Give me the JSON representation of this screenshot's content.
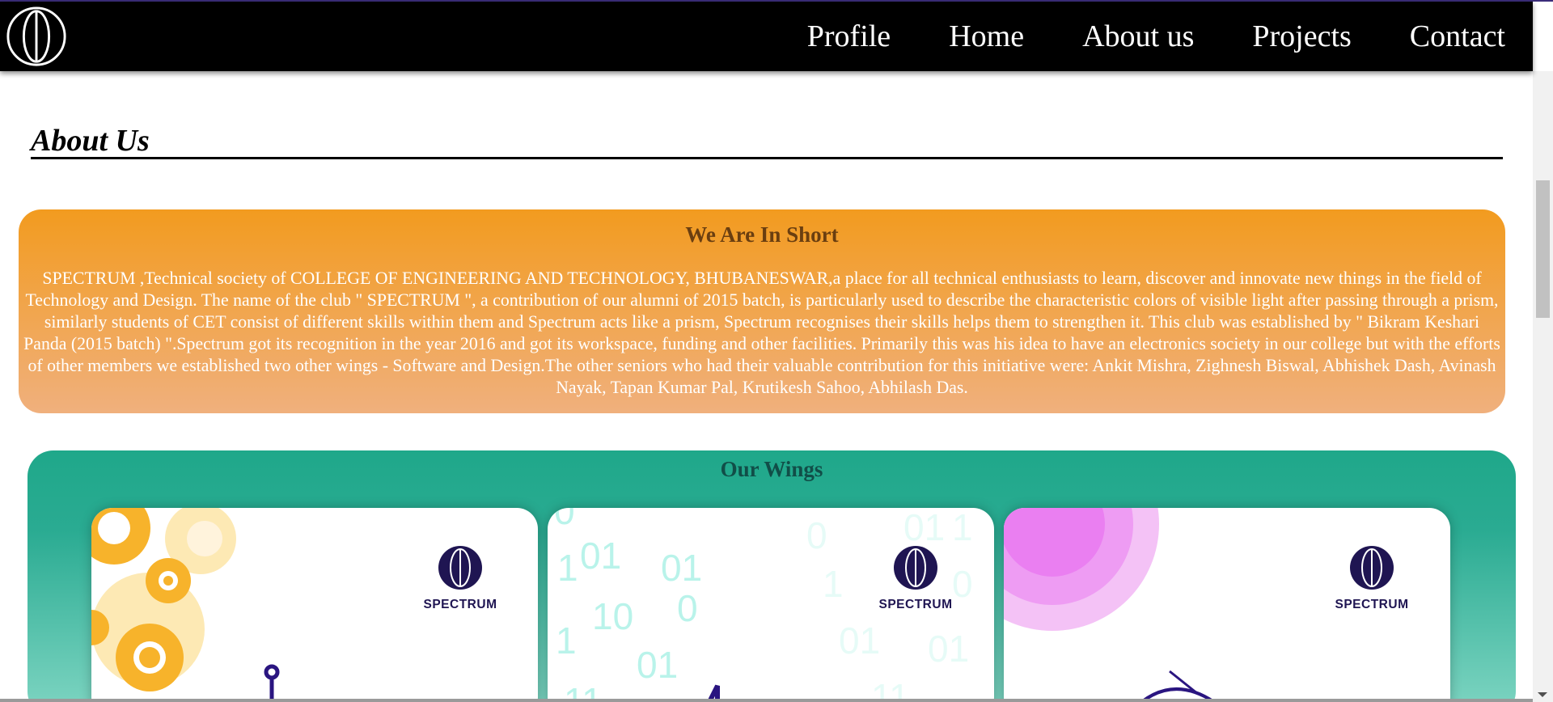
{
  "nav": {
    "logo_icon": "spectrum-logo-icon",
    "links": [
      "Profile",
      "Home",
      "About us",
      "Projects",
      "Contact"
    ]
  },
  "about": {
    "title": "About Us"
  },
  "short": {
    "title": "We Are In Short",
    "text": "SPECTRUM ,Technical society of COLLEGE OF ENGINEERING AND TECHNOLOGY, BHUBANESWAR,a place for all technical enthusiasts to learn, discover and innovate new things in the field of Technology and Design. The name of the club \" SPECTRUM \", a contribution of our alumni of 2015 batch, is particularly used to describe the characteristic colors of visible light after passing through a prism, similarly students of CET consist of different skills within them and Spectrum acts like a prism, Spectrum recognises their skills helps them to strengthen it. This club was established by \" Bikram Keshari Panda (2015 batch) \".Spectrum got its recognition in the year 2016 and got its workspace, funding and other facilities. Primarily this was his idea to have an electronics society in our college but with the efforts of other members we established two other wings - Software and Design.The other seniors who had their valuable contribution for this initiative were: Ankit Mishra, Zighnesh Biswal, Abhishek Dash, Avinash Nayak, Tapan Kumar Pal, Krutikesh Sahoo, Abhilash Das."
  },
  "wings": {
    "title": "Our Wings",
    "cards": [
      {
        "brand": "SPECTRUM",
        "art_icon": "gears-icon"
      },
      {
        "brand": "SPECTRUM",
        "art_icon": "binary-code-icon"
      },
      {
        "brand": "SPECTRUM",
        "art_icon": "design-circles-icon"
      }
    ]
  },
  "colors": {
    "navbar": "#000000",
    "short_card_top": "#f29b1f",
    "short_card_bottom": "#f0b07d",
    "wings_card": "#1fa88a",
    "brand": "#1f1552"
  }
}
